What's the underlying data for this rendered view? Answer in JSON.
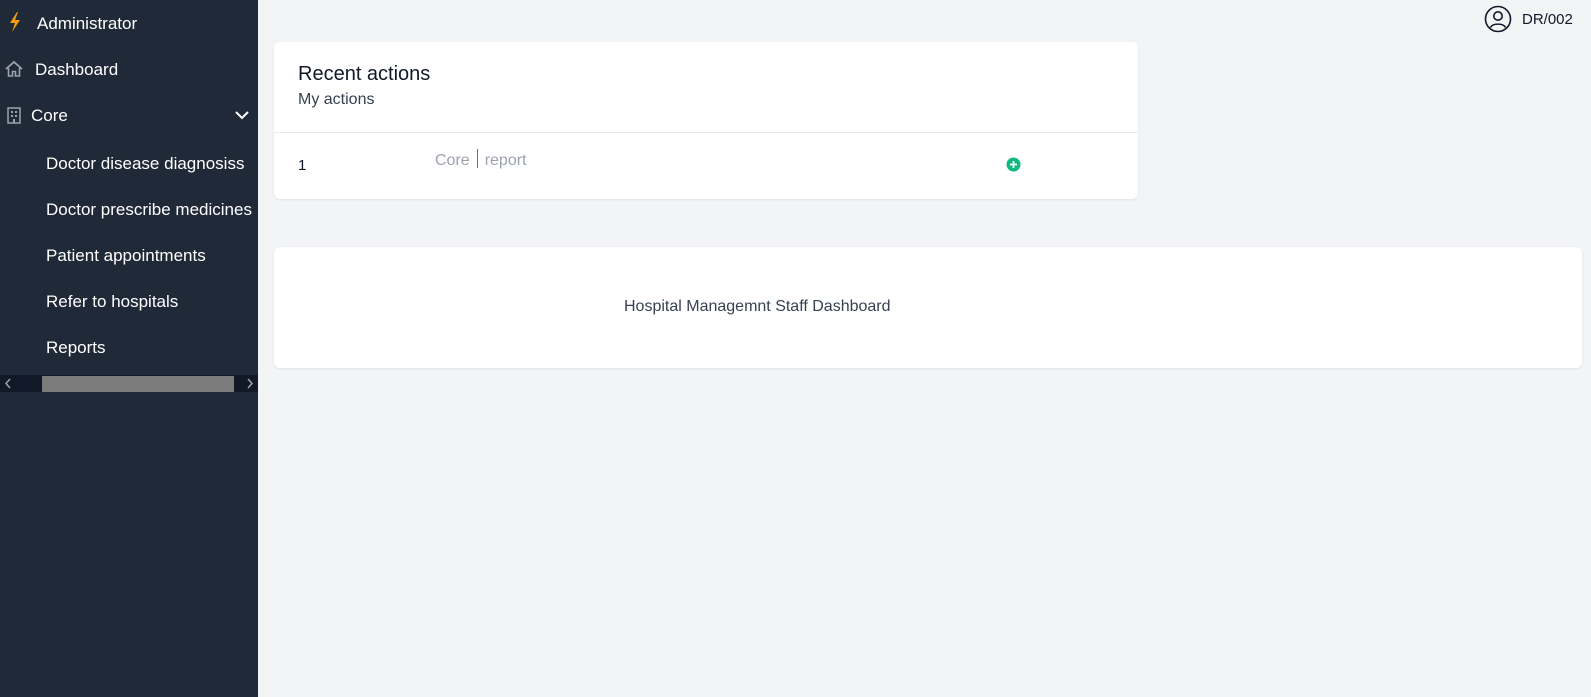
{
  "sidebar": {
    "brand_label": "Administrator",
    "items": [
      {
        "label": "Dashboard",
        "icon": "home-icon"
      },
      {
        "label": "Core",
        "icon": "building-icon",
        "expanded": true
      }
    ],
    "core_children": [
      {
        "label": "Doctor disease diagnosiss"
      },
      {
        "label": "Doctor prescribe medicines"
      },
      {
        "label": "Patient appointments"
      },
      {
        "label": "Refer to hospitals"
      },
      {
        "label": "Reports"
      }
    ]
  },
  "header": {
    "username": "DR/002",
    "icon": "user-circle-icon"
  },
  "recent_actions": {
    "title": "Recent actions",
    "subtitle": "My actions",
    "rows": [
      {
        "number": "1",
        "app": "Core",
        "model": "report",
        "icon": "add-circle-icon"
      }
    ]
  },
  "dashboard_card": {
    "text": "Hospital Managemnt Staff Dashboard"
  },
  "colors": {
    "sidebar_bg": "#1f2937",
    "page_bg": "#f3f4f6",
    "accent_bolt": "#f59e0b",
    "add_icon": "#10b981"
  }
}
